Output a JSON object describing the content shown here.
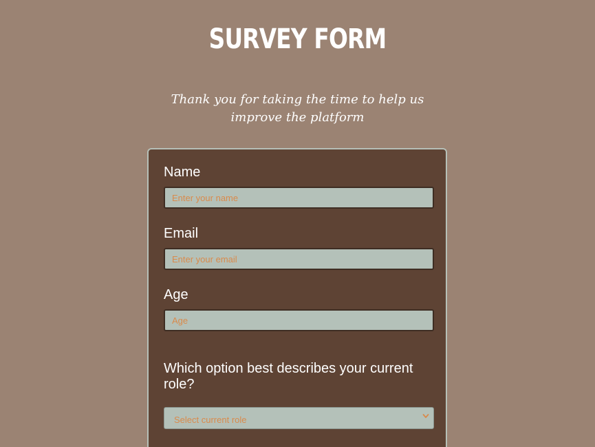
{
  "header": {
    "title": "SURVEY FORM",
    "description": "Thank you for taking the time to help us improve the platform"
  },
  "form": {
    "name": {
      "label": "Name",
      "placeholder": "Enter your name"
    },
    "email": {
      "label": "Email",
      "placeholder": "Enter your email"
    },
    "age": {
      "label": "Age",
      "placeholder": "Age"
    },
    "role": {
      "question": "Which option best describes your current role?",
      "selected": "Select current role",
      "icon": "chevron-down-icon"
    }
  },
  "colors": {
    "page_background": "#9b8373",
    "card_background": "#5e4334",
    "input_background": "#b4c1b9",
    "placeholder_text": "#d98a4b"
  }
}
